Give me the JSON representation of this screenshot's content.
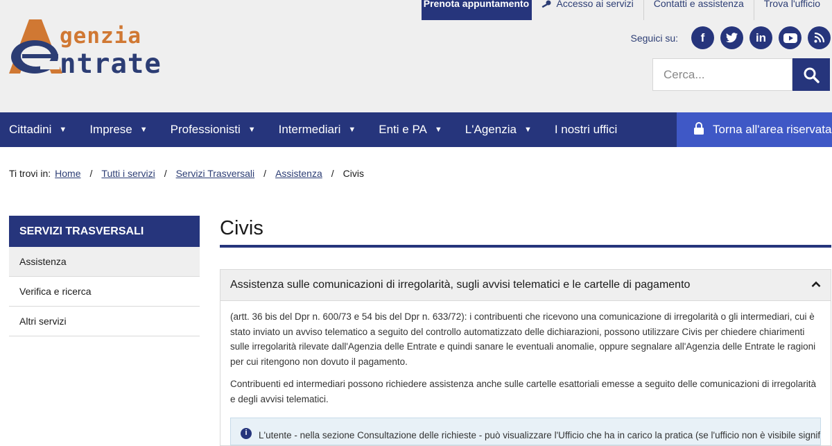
{
  "logo": {
    "line1": "genzia",
    "line2": "ntrate"
  },
  "topnav": {
    "prenota": "Prenota appuntamento",
    "accesso": "Accesso ai servizi",
    "contatti": "Contatti e assistenza",
    "trova": "Trova l'ufficio"
  },
  "social": {
    "label": "Seguici su:",
    "items": [
      "facebook-icon",
      "twitter-icon",
      "linkedin-icon",
      "youtube-icon",
      "rss-icon"
    ]
  },
  "search": {
    "placeholder": "Cerca..."
  },
  "mainnav": {
    "items": [
      {
        "label": "Cittadini",
        "dropdown": true
      },
      {
        "label": "Imprese",
        "dropdown": true
      },
      {
        "label": "Professionisti",
        "dropdown": true
      },
      {
        "label": "Intermediari",
        "dropdown": true
      },
      {
        "label": "Enti e PA",
        "dropdown": true
      },
      {
        "label": "L'Agenzia",
        "dropdown": true
      },
      {
        "label": "I nostri uffici",
        "dropdown": false
      }
    ],
    "area_label": "Torna all'area riservata"
  },
  "breadcrumb": {
    "prefix": "Ti trovi in:",
    "links": [
      "Home",
      "Tutti i servizi",
      "Servizi Trasversali",
      "Assistenza"
    ],
    "current": "Civis"
  },
  "sidebar": {
    "header": "SERVIZI TRASVERSALI",
    "items": [
      "Assistenza",
      "Verifica e ricerca",
      "Altri servizi"
    ],
    "active": 0
  },
  "main": {
    "title": "Civis",
    "accordion_title": "Assistenza sulle comunicazioni di irregolarità, sugli avvisi telematici e le cartelle di pagamento",
    "paragraph1": "(artt. 36 bis del Dpr n. 600/73 e 54 bis del Dpr n. 633/72): i contribuenti che ricevono una comunicazione di irregolarità o gli intermediari, cui è stato inviato un avviso telematico a seguito del controllo automatizzato delle dichiarazioni, possono utilizzare Civis per chiedere chiarimenti sulle irregolarità rilevate dall'Agenzia delle Entrate e quindi sanare le eventuali anomalie, oppure segnalare all'Agenzia delle Entrate le ragioni per cui ritengono non dovuto il pagamento.",
    "paragraph2": "Contribuenti ed intermediari possono richiedere assistenza anche sulle cartelle esattoriali emesse a seguito delle comunicazioni di irregolarità e degli avvisi telematici.",
    "info_text": "L'utente - nella sezione Consultazione delle richieste - può visualizzare l'Ufficio che ha in carico la pratica (se l'ufficio non è visibile significa"
  },
  "colors": {
    "brand": "#26357c",
    "accent": "#3f58c6",
    "logo_orange": "#d07833"
  }
}
